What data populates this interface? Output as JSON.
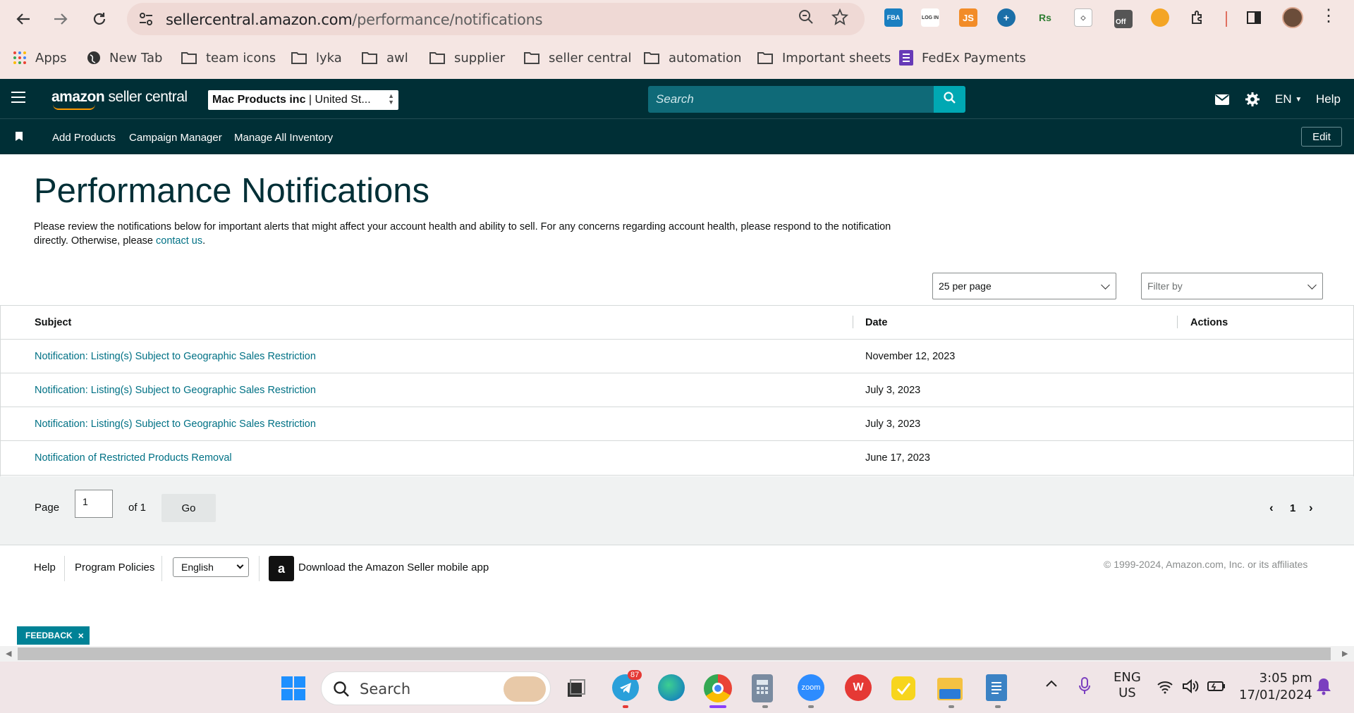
{
  "browser": {
    "url_domain": "sellercentral.amazon.com",
    "url_path": "/performance/notifications",
    "bookmarks": [
      {
        "label": "Apps"
      },
      {
        "label": "New Tab"
      },
      {
        "label": "team icons"
      },
      {
        "label": "lyka"
      },
      {
        "label": "awl"
      },
      {
        "label": "supplier"
      },
      {
        "label": "seller central"
      },
      {
        "label": "automation"
      },
      {
        "label": "Important sheets"
      },
      {
        "label": "FedEx Payments"
      }
    ],
    "extensions": {
      "fba": "FBA",
      "login": "LOG IN",
      "js": "JS",
      "rs": "Rs",
      "off_badge": "Off"
    }
  },
  "header": {
    "logo_bold": "amazon",
    "logo_rest": " seller central",
    "account_name": "Mac Products inc",
    "account_region": " | United St...",
    "search_placeholder": "Search",
    "language": "EN",
    "help": "Help",
    "edit": "Edit"
  },
  "subnav": {
    "items": [
      "Add Products",
      "Campaign Manager",
      "Manage All Inventory"
    ]
  },
  "page": {
    "title": "Performance Notifications",
    "intro": "Please review the notifications below for important alerts that might affect your account health and ability to sell. For any concerns regarding account health, please respond to the notification directly. Otherwise, please ",
    "contact_link": "contact us",
    "intro_end": ".",
    "per_page": "25 per page",
    "filter_placeholder": "Filter by"
  },
  "table": {
    "headers": {
      "subject": "Subject",
      "date": "Date",
      "actions": "Actions"
    },
    "rows": [
      {
        "subject": "Notification: Listing(s) Subject to Geographic Sales Restriction",
        "date": "November 12, 2023"
      },
      {
        "subject": "Notification: Listing(s) Subject to Geographic Sales Restriction",
        "date": "July 3, 2023"
      },
      {
        "subject": "Notification: Listing(s) Subject to Geographic Sales Restriction",
        "date": "July 3, 2023"
      },
      {
        "subject": "Notification of Restricted Products Removal",
        "date": "June 17, 2023"
      }
    ]
  },
  "pager": {
    "page_label": "Page",
    "page_value": "1",
    "of_label": "of 1",
    "go": "Go",
    "current": "1"
  },
  "footer": {
    "help": "Help",
    "policies": "Program Policies",
    "language": "English",
    "app_link": "Download the Amazon Seller mobile app",
    "app_badge": "a",
    "copyright": "© 1999-2024, Amazon.com, Inc. or its affiliates"
  },
  "feedback": {
    "label": "FEEDBACK",
    "close": "×"
  },
  "taskbar": {
    "search": "Search",
    "telegram_badge": "87",
    "zoom_label": "zoom",
    "lang_line1": "ENG",
    "lang_line2": "US",
    "time": "3:05 pm",
    "date": "17/01/2024"
  },
  "colors": {
    "header_bg": "#002f36",
    "link": "#007185",
    "search_btn": "#00a8b3",
    "feedback_bg": "#008296"
  }
}
